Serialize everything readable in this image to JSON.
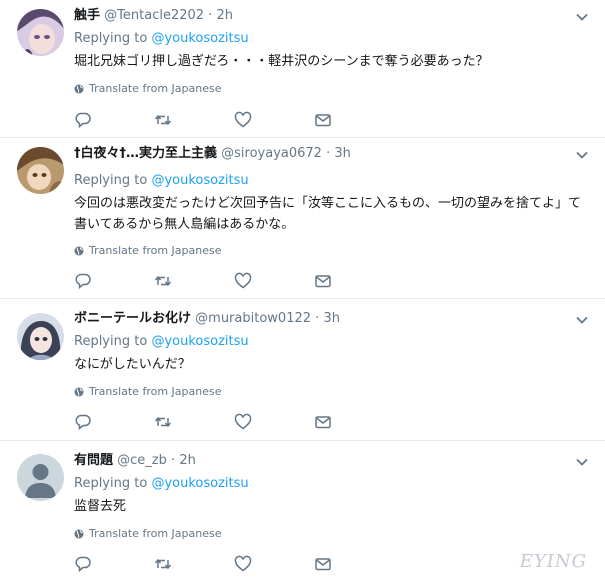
{
  "tweets": [
    {
      "name": "触手",
      "handle": "@Tentacle2202",
      "dot": "·",
      "time": "2h",
      "replying_label": "Replying to",
      "replying_to": "@youkosozitsu",
      "text": "堀北兄妹ゴリ押し過ぎだろ・・・軽井沢のシーンまで奪う必要あった？",
      "translate": "Translate from Japanese"
    },
    {
      "name": "†白夜々†…実力至上主義",
      "handle": "@siroyaya0672",
      "dot": "·",
      "time": "3h",
      "replying_label": "Replying to",
      "replying_to": "@youkosozitsu",
      "text": "今回のは悪改変だったけど次回予告に「汝等ここに入るもの、一切の望みを捨てよ」て書いてあるから無人島編はあるかな。",
      "translate": "Translate from Japanese"
    },
    {
      "name": "ボニーテールお化け",
      "handle": "@murabitow0122",
      "dot": "·",
      "time": "3h",
      "replying_label": "Replying to",
      "replying_to": "@youkosozitsu",
      "text": "なにがしたいんだ？",
      "translate": "Translate from Japanese"
    },
    {
      "name": "有問題",
      "handle": "@ce_zb",
      "dot": "·",
      "time": "2h",
      "replying_label": "Replying to",
      "replying_to": "@youkosozitsu",
      "text": "监督去死",
      "translate": "Translate from Japanese"
    }
  ],
  "icons": [
    "chevron-down-icon",
    "globe-icon",
    "reply-icon",
    "retweet-icon",
    "like-icon",
    "direct-message-icon"
  ],
  "colors": {
    "link": "#1da1f2",
    "muted": "#657786",
    "text": "#14171a",
    "divider": "#e6ecf0"
  },
  "watermark": "EYING"
}
